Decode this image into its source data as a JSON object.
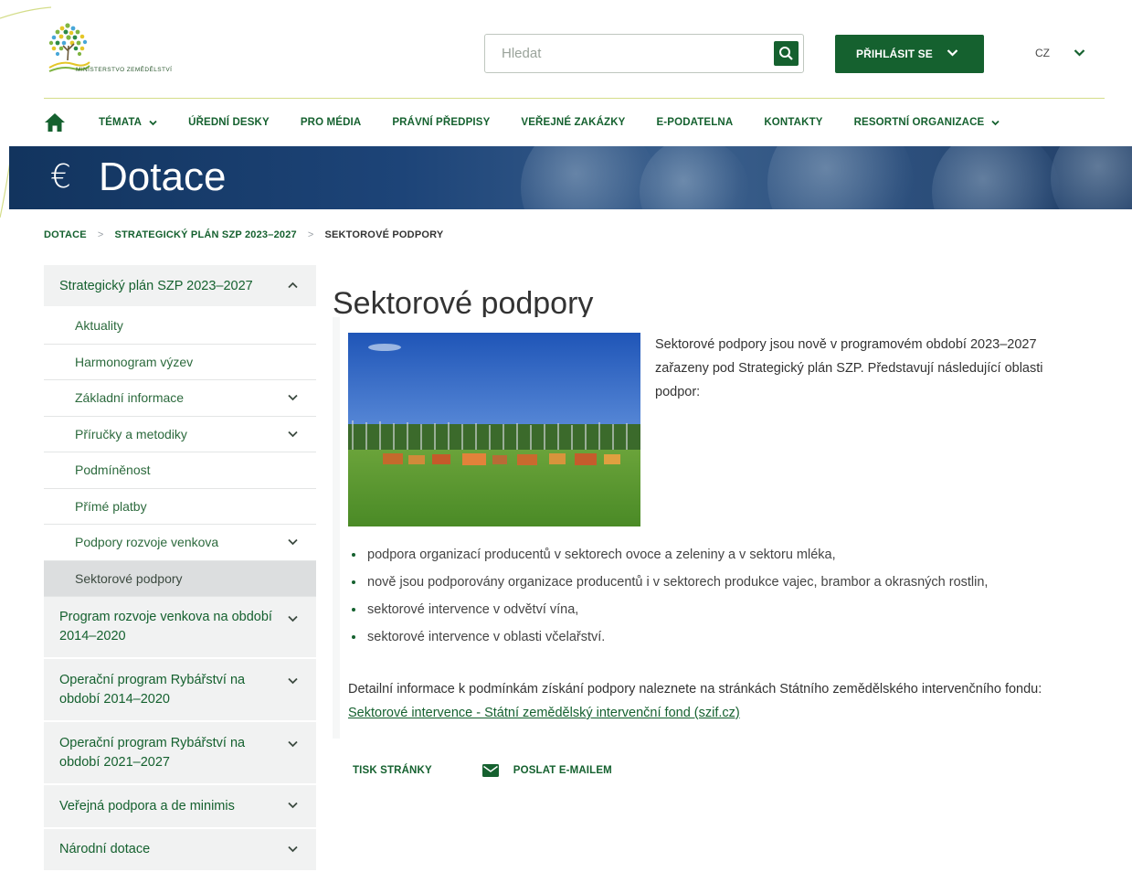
{
  "header": {
    "logo_text": "MINISTERSTVO ZEMĚDĚLSTVÍ",
    "search": {
      "placeholder": "Hledat"
    },
    "login_label": "PŘIHLÁSIT SE",
    "language": "CZ"
  },
  "nav": {
    "items": [
      {
        "label": "TÉMATA",
        "dropdown": true
      },
      {
        "label": "ÚŘEDNÍ DESKY"
      },
      {
        "label": "PRO MÉDIA"
      },
      {
        "label": "PRÁVNÍ PŘEDPISY"
      },
      {
        "label": "VEŘEJNÉ ZAKÁZKY"
      },
      {
        "label": "E-PODATELNA"
      },
      {
        "label": "KONTAKTY"
      },
      {
        "label": "RESORTNÍ ORGANIZACE",
        "dropdown": true
      }
    ]
  },
  "hero": {
    "icon": "€",
    "title": "Dotace"
  },
  "breadcrumb": {
    "items": [
      "DOTACE",
      "STRATEGICKÝ PLÁN SZP 2023–2027"
    ],
    "separator": ">",
    "current": "SEKTOROVÉ PODPORY"
  },
  "sidebar": {
    "section_title": "Strategický plán SZP 2023–2027",
    "sub_items": [
      {
        "label": "Aktuality",
        "expandable": false,
        "active": false
      },
      {
        "label": "Harmonogram výzev",
        "expandable": false,
        "active": false
      },
      {
        "label": "Základní informace",
        "expandable": true,
        "active": false
      },
      {
        "label": "Příručky a metodiky",
        "expandable": true,
        "active": false
      },
      {
        "label": "Podmíněnost",
        "expandable": false,
        "active": false
      },
      {
        "label": "Přímé platby",
        "expandable": false,
        "active": false
      },
      {
        "label": "Podpory rozvoje venkova",
        "expandable": true,
        "active": false
      },
      {
        "label": "Sektorové podpory",
        "expandable": false,
        "active": true
      }
    ],
    "main_items": [
      {
        "label": "Program rozvoje venkova na období 2014–2020"
      },
      {
        "label": "Operační program Rybářství na období 2014–2020"
      },
      {
        "label": "Operační program Rybářství na období 2021–2027"
      },
      {
        "label": "Veřejná podpora a de minimis"
      },
      {
        "label": "Národní dotace"
      }
    ]
  },
  "main": {
    "title": "Sektorové podpory",
    "intro": "Sektorové podpory jsou nově v programovém období 2023–2027 zařazeny pod Strategický plán SZP. Představují následující oblasti podpor:",
    "bullets": [
      "podpora organizací producentů v sektorech ovoce a zeleniny a v sektoru mléka,",
      "nově jsou podporovány organizace producentů i v sektorech produkce vajec, brambor a okrasných rostlin,",
      "sektorové intervence v odvětví vína,",
      "sektorové intervence v oblasti včelařství."
    ],
    "detail_text": "Detailní informace k podmínkám získání podpory naleznete na stránkách Státního zemědělského intervenčního fondu: ",
    "detail_link": "Sektorové intervence - Státní zemědělský intervenční fond (szif.cz)"
  },
  "tools": {
    "print_label": "TISK STRÁNKY",
    "email_label": "POSLAT E-MAILEM"
  },
  "colors": {
    "brand_green": "#15612f",
    "accent_line": "#d4dd8a",
    "hero_blue": "#1d4478",
    "sidebar_bg": "#f1f2f2",
    "active_bg": "#dcdedf"
  },
  "icons": {
    "home": "home-icon",
    "search": "search-icon",
    "chevron": "chevron-down-icon",
    "euro": "euro-icon",
    "mail": "mail-icon"
  }
}
